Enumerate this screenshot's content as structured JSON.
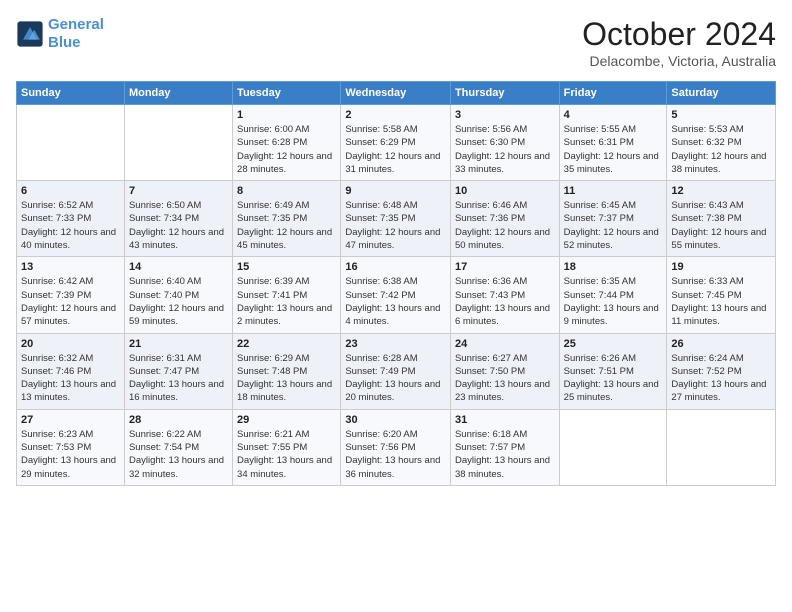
{
  "logo": {
    "line1": "General",
    "line2": "Blue"
  },
  "title": "October 2024",
  "location": "Delacombe, Victoria, Australia",
  "days_header": [
    "Sunday",
    "Monday",
    "Tuesday",
    "Wednesday",
    "Thursday",
    "Friday",
    "Saturday"
  ],
  "weeks": [
    [
      {
        "day": "",
        "content": ""
      },
      {
        "day": "",
        "content": ""
      },
      {
        "day": "1",
        "content": "Sunrise: 6:00 AM\nSunset: 6:28 PM\nDaylight: 12 hours and 28 minutes."
      },
      {
        "day": "2",
        "content": "Sunrise: 5:58 AM\nSunset: 6:29 PM\nDaylight: 12 hours and 31 minutes."
      },
      {
        "day": "3",
        "content": "Sunrise: 5:56 AM\nSunset: 6:30 PM\nDaylight: 12 hours and 33 minutes."
      },
      {
        "day": "4",
        "content": "Sunrise: 5:55 AM\nSunset: 6:31 PM\nDaylight: 12 hours and 35 minutes."
      },
      {
        "day": "5",
        "content": "Sunrise: 5:53 AM\nSunset: 6:32 PM\nDaylight: 12 hours and 38 minutes."
      }
    ],
    [
      {
        "day": "6",
        "content": "Sunrise: 6:52 AM\nSunset: 7:33 PM\nDaylight: 12 hours and 40 minutes."
      },
      {
        "day": "7",
        "content": "Sunrise: 6:50 AM\nSunset: 7:34 PM\nDaylight: 12 hours and 43 minutes."
      },
      {
        "day": "8",
        "content": "Sunrise: 6:49 AM\nSunset: 7:35 PM\nDaylight: 12 hours and 45 minutes."
      },
      {
        "day": "9",
        "content": "Sunrise: 6:48 AM\nSunset: 7:35 PM\nDaylight: 12 hours and 47 minutes."
      },
      {
        "day": "10",
        "content": "Sunrise: 6:46 AM\nSunset: 7:36 PM\nDaylight: 12 hours and 50 minutes."
      },
      {
        "day": "11",
        "content": "Sunrise: 6:45 AM\nSunset: 7:37 PM\nDaylight: 12 hours and 52 minutes."
      },
      {
        "day": "12",
        "content": "Sunrise: 6:43 AM\nSunset: 7:38 PM\nDaylight: 12 hours and 55 minutes."
      }
    ],
    [
      {
        "day": "13",
        "content": "Sunrise: 6:42 AM\nSunset: 7:39 PM\nDaylight: 12 hours and 57 minutes."
      },
      {
        "day": "14",
        "content": "Sunrise: 6:40 AM\nSunset: 7:40 PM\nDaylight: 12 hours and 59 minutes."
      },
      {
        "day": "15",
        "content": "Sunrise: 6:39 AM\nSunset: 7:41 PM\nDaylight: 13 hours and 2 minutes."
      },
      {
        "day": "16",
        "content": "Sunrise: 6:38 AM\nSunset: 7:42 PM\nDaylight: 13 hours and 4 minutes."
      },
      {
        "day": "17",
        "content": "Sunrise: 6:36 AM\nSunset: 7:43 PM\nDaylight: 13 hours and 6 minutes."
      },
      {
        "day": "18",
        "content": "Sunrise: 6:35 AM\nSunset: 7:44 PM\nDaylight: 13 hours and 9 minutes."
      },
      {
        "day": "19",
        "content": "Sunrise: 6:33 AM\nSunset: 7:45 PM\nDaylight: 13 hours and 11 minutes."
      }
    ],
    [
      {
        "day": "20",
        "content": "Sunrise: 6:32 AM\nSunset: 7:46 PM\nDaylight: 13 hours and 13 minutes."
      },
      {
        "day": "21",
        "content": "Sunrise: 6:31 AM\nSunset: 7:47 PM\nDaylight: 13 hours and 16 minutes."
      },
      {
        "day": "22",
        "content": "Sunrise: 6:29 AM\nSunset: 7:48 PM\nDaylight: 13 hours and 18 minutes."
      },
      {
        "day": "23",
        "content": "Sunrise: 6:28 AM\nSunset: 7:49 PM\nDaylight: 13 hours and 20 minutes."
      },
      {
        "day": "24",
        "content": "Sunrise: 6:27 AM\nSunset: 7:50 PM\nDaylight: 13 hours and 23 minutes."
      },
      {
        "day": "25",
        "content": "Sunrise: 6:26 AM\nSunset: 7:51 PM\nDaylight: 13 hours and 25 minutes."
      },
      {
        "day": "26",
        "content": "Sunrise: 6:24 AM\nSunset: 7:52 PM\nDaylight: 13 hours and 27 minutes."
      }
    ],
    [
      {
        "day": "27",
        "content": "Sunrise: 6:23 AM\nSunset: 7:53 PM\nDaylight: 13 hours and 29 minutes."
      },
      {
        "day": "28",
        "content": "Sunrise: 6:22 AM\nSunset: 7:54 PM\nDaylight: 13 hours and 32 minutes."
      },
      {
        "day": "29",
        "content": "Sunrise: 6:21 AM\nSunset: 7:55 PM\nDaylight: 13 hours and 34 minutes."
      },
      {
        "day": "30",
        "content": "Sunrise: 6:20 AM\nSunset: 7:56 PM\nDaylight: 13 hours and 36 minutes."
      },
      {
        "day": "31",
        "content": "Sunrise: 6:18 AM\nSunset: 7:57 PM\nDaylight: 13 hours and 38 minutes."
      },
      {
        "day": "",
        "content": ""
      },
      {
        "day": "",
        "content": ""
      }
    ]
  ]
}
